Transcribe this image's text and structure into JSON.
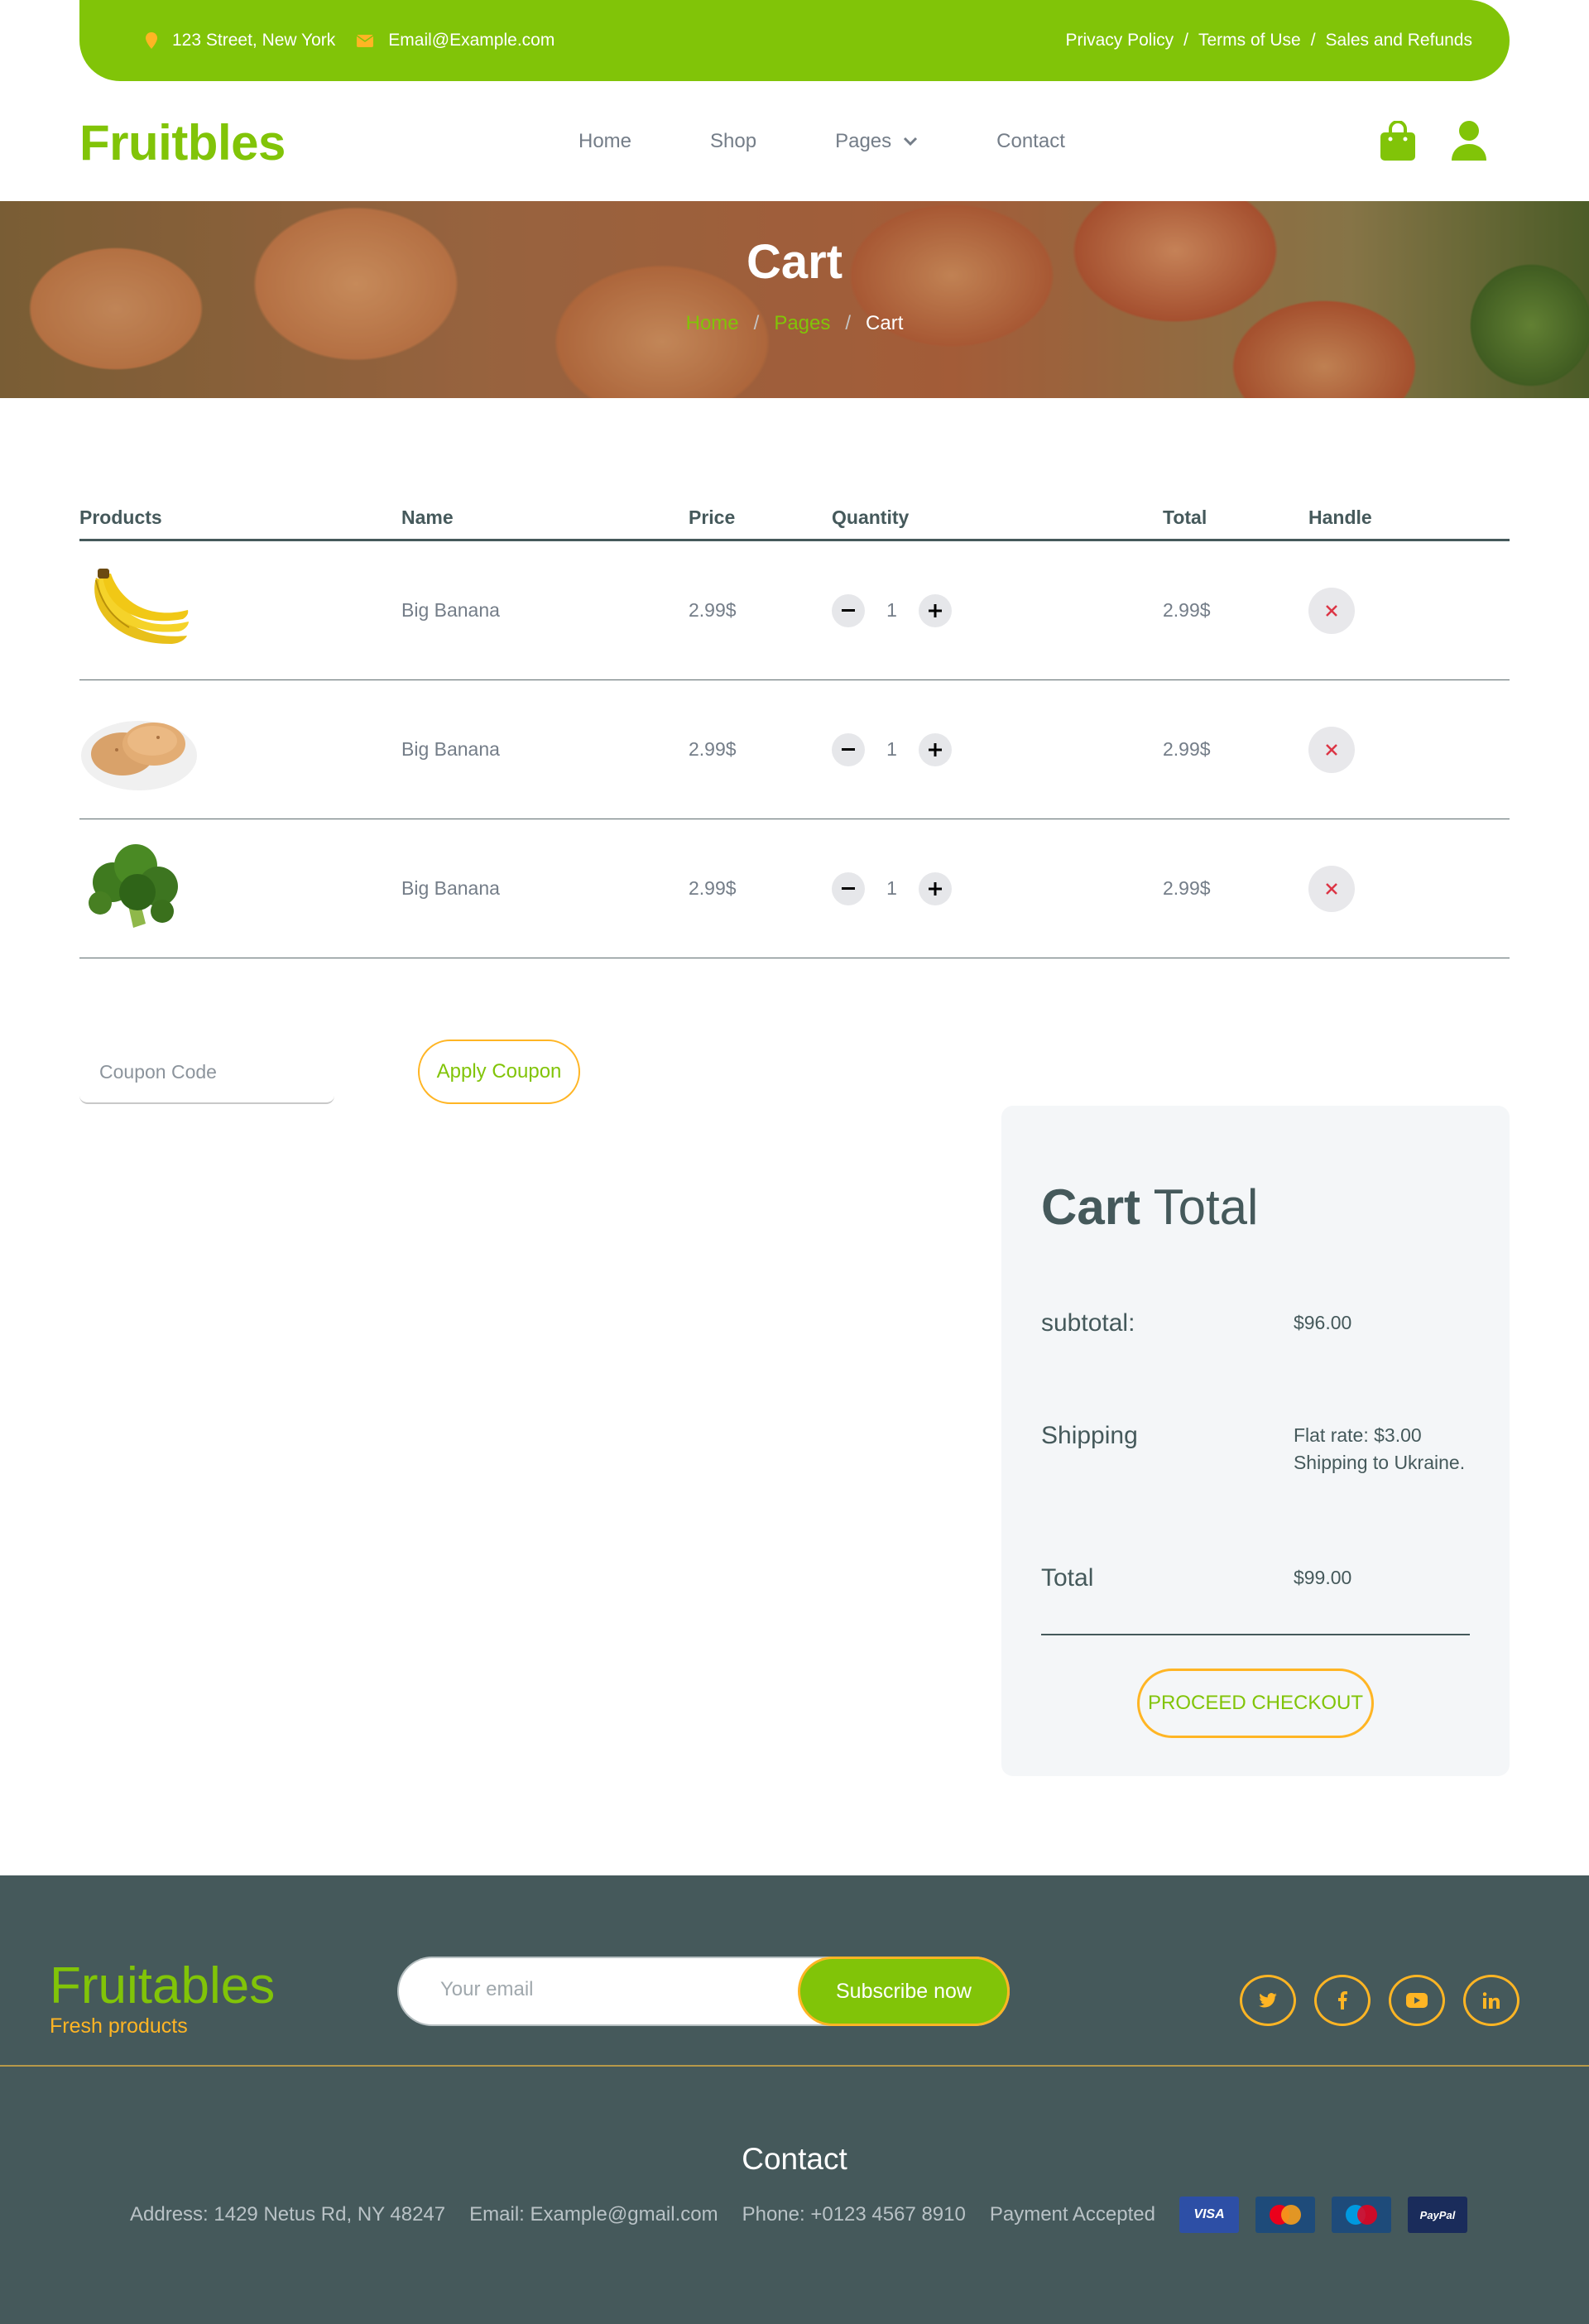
{
  "topbar": {
    "address": "123 Street, New York",
    "email": "Email@Example.com",
    "links": [
      "Privacy Policy",
      "Terms of Use",
      "Sales and Refunds"
    ],
    "separator": "/"
  },
  "navbar": {
    "logo": "Fruitbles",
    "links": [
      "Home",
      "Shop",
      "Pages",
      "Contact"
    ]
  },
  "hero": {
    "title": "Cart",
    "breadcrumb": [
      "Home",
      "Pages",
      "Cart"
    ],
    "separator": "/"
  },
  "cart": {
    "headers": [
      "Products",
      "Name",
      "Price",
      "Quantity",
      "Total",
      "Handle"
    ],
    "rows": [
      {
        "image": "banana",
        "name": "Big Banana",
        "price": "2.99$",
        "quantity": "1",
        "total": "2.99$"
      },
      {
        "image": "potato",
        "name": "Big Banana",
        "price": "2.99$",
        "quantity": "1",
        "total": "2.99$"
      },
      {
        "image": "broccoli",
        "name": "Big Banana",
        "price": "2.99$",
        "quantity": "1",
        "total": "2.99$"
      }
    ]
  },
  "coupon": {
    "placeholder": "Coupon Code",
    "button": "Apply Coupon"
  },
  "cart_total": {
    "title_bold": "Cart",
    "title_light": "Total",
    "subtotal_label": "subtotal:",
    "subtotal_value": "$96.00",
    "shipping_label": "Shipping",
    "shipping_value": "Flat rate: $3.00 Shipping to Ukraine.",
    "total_label": "Total",
    "total_value": "$99.00",
    "checkout_button": "PROCEED CHECKOUT"
  },
  "footer": {
    "logo": "Fruitables",
    "tagline": "Fresh products",
    "email_placeholder": "Your email",
    "subscribe_button": "Subscribe now",
    "social": [
      "twitter-icon",
      "facebook-icon",
      "youtube-icon",
      "linkedin-icon"
    ],
    "contact_title": "Contact",
    "address": "Address: 1429 Netus Rd, NY 48247",
    "email": "Email: Example@gmail.com",
    "phone": "Phone: +0123 4567 8910",
    "payment_label": "Payment Accepted",
    "payment_methods": [
      "VISA",
      "MasterCard",
      "Maestro",
      "PayPal"
    ]
  },
  "colors": {
    "primary": "#81c408",
    "secondary": "#ffb524",
    "dark": "#45595b"
  }
}
